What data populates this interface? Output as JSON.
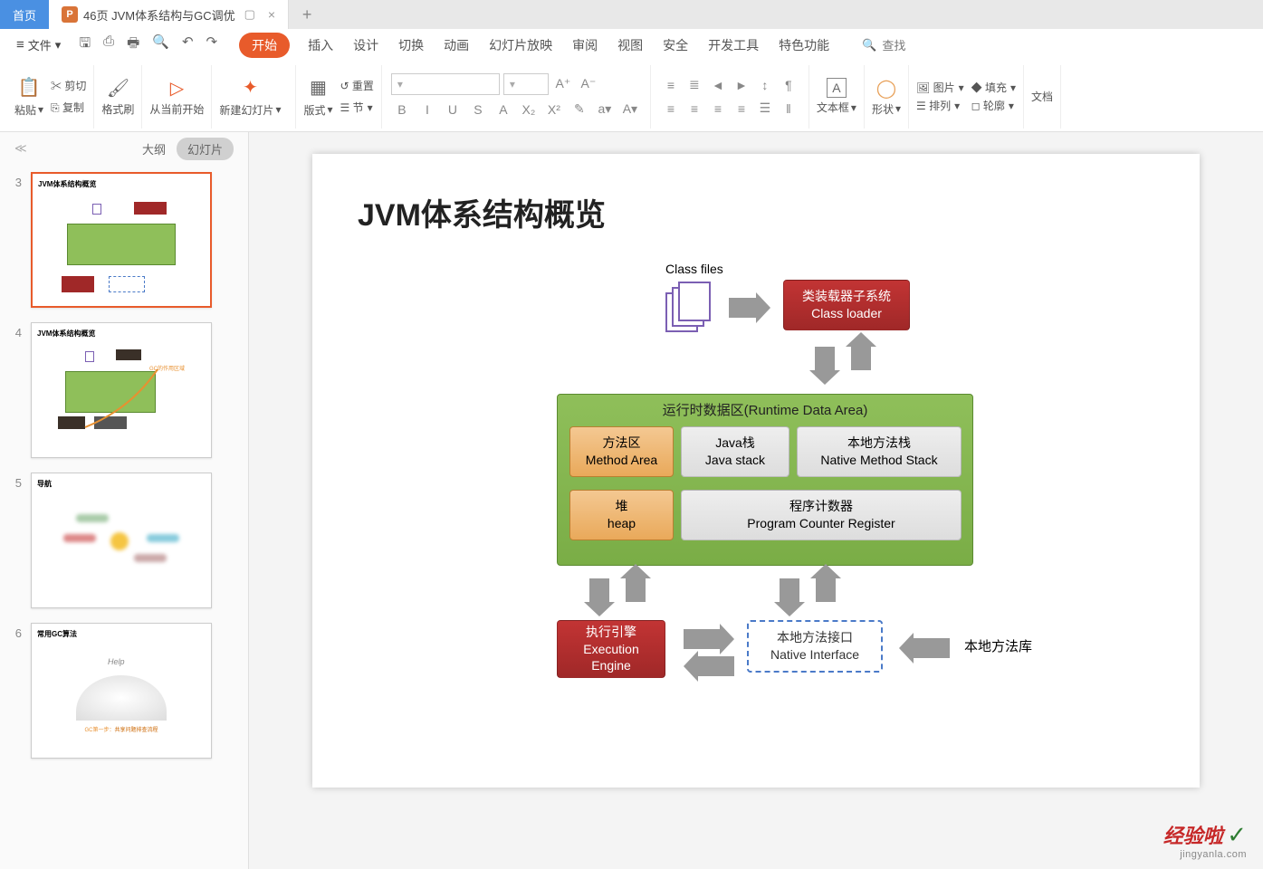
{
  "tabs": {
    "home": "首页",
    "doc_badge": "P",
    "doc": "46页 JVM体系结构与GC调优",
    "dup": "▢",
    "close": "×",
    "new": "+"
  },
  "file": {
    "menu": "文件",
    "hamburger": "≡",
    "dropdown": "▾"
  },
  "qat": {
    "save": "🖫",
    "export": "⎙",
    "print": "🖶",
    "preview": "🔍",
    "undo": "↶",
    "redo": "↷"
  },
  "menu_tabs": [
    "开始",
    "插入",
    "设计",
    "切换",
    "动画",
    "幻灯片放映",
    "审阅",
    "视图",
    "安全",
    "开发工具",
    "特色功能"
  ],
  "search": {
    "icon": "🔍",
    "label": "查找"
  },
  "ribbon": {
    "paste": {
      "ico": "📋",
      "lbl": "粘贴",
      "cut": "✂ 剪切",
      "copy": "⎘ 复制"
    },
    "format": {
      "ico": "🖌",
      "lbl": "格式刷"
    },
    "playfrom": {
      "ico": "▷",
      "lbl": "从当前开始"
    },
    "newslide": {
      "ico": "✦",
      "lbl": "新建幻灯片"
    },
    "layout": {
      "lbl": "版式",
      "reset": "↺ 重置",
      "section": "☰ 节"
    },
    "font": {
      "name_ph": "",
      "size_ph": "",
      "ainc": "A⁺",
      "adec": "A⁻"
    },
    "ftools1": [
      "B",
      "I",
      "U",
      "S",
      "A",
      "X₂",
      "X²",
      "✎",
      "a▾",
      "A▾"
    ],
    "ftools2": [
      "A",
      "▾"
    ],
    "para1": [
      "≡",
      "≣",
      "◄",
      "►",
      "↕",
      "¶"
    ],
    "para2": [
      "≡",
      "≡",
      "≡",
      "≡",
      "☰",
      "‖"
    ],
    "textbox": {
      "ico": "A",
      "lbl": "文本框"
    },
    "shape": {
      "ico": "◯",
      "lbl": "形状"
    },
    "pic": "🖼 图片",
    "fill": "◆ 填充",
    "arrange": "☰ 排列",
    "outline": "◻ 轮廓",
    "docclip": "文档"
  },
  "side": {
    "chev": "≪",
    "outline": "大纲",
    "slides": "幻灯片"
  },
  "thumbs": [
    {
      "n": "3",
      "title": "JVM体系结构概览",
      "sel": true
    },
    {
      "n": "4",
      "title": "JVM体系结构概览",
      "sel": false
    },
    {
      "n": "5",
      "title": "导航",
      "sel": false
    },
    {
      "n": "6",
      "title": "常用GC算法",
      "sel": false
    }
  ],
  "slide": {
    "title": "JVM体系结构概览",
    "classfiles": "Class files",
    "classloader": {
      "l1": "类装载器子系统",
      "l2": "Class loader"
    },
    "runtime": "运行时数据区(Runtime Data Area)",
    "method": {
      "l1": "方法区",
      "l2": "Method Area"
    },
    "javastack": {
      "l1": "Java栈",
      "l2": "Java stack"
    },
    "native": {
      "l1": "本地方法栈",
      "l2": "Native Method Stack"
    },
    "heap": {
      "l1": "堆",
      "l2": "heap"
    },
    "pcr": {
      "l1": "程序计数器",
      "l2": "Program Counter Register"
    },
    "exec": {
      "l1": "执行引擎",
      "l2": "Execution",
      "l3": "Engine"
    },
    "ni": {
      "l1": "本地方法接口",
      "l2": "Native Interface"
    },
    "nl": "本地方法库"
  },
  "wm": {
    "l1": "经验啦",
    "chk": "✓",
    "l2": "jingyanla.com"
  }
}
